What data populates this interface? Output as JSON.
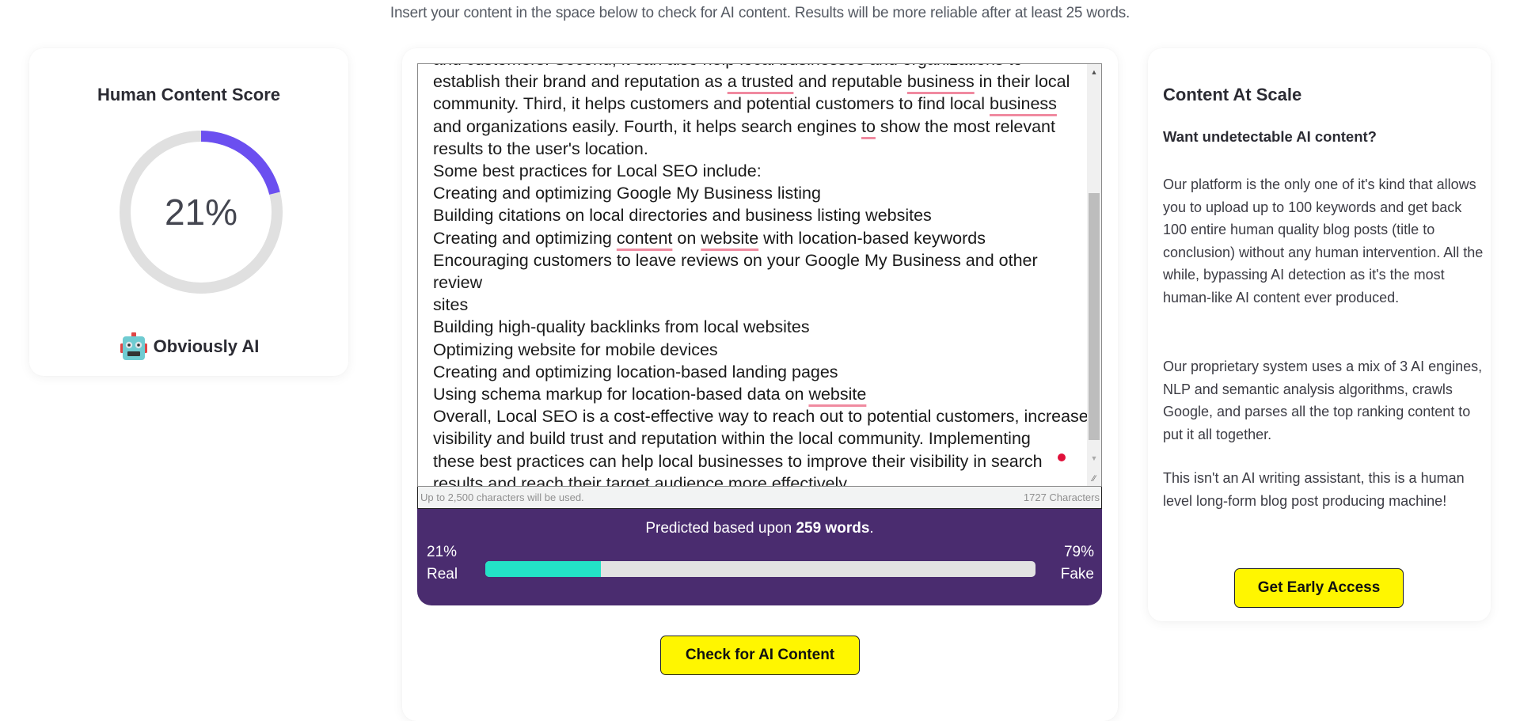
{
  "intro": {
    "text": "Insert your content in the space below to check for AI content. Results will be more reliable after at least 25 words."
  },
  "score_card": {
    "title": "Human Content Score",
    "score_percent": 21,
    "score_label": "21%",
    "ring_colors": {
      "filled": "#6b4ff0",
      "track": "#e0e0e0"
    },
    "verdict_icon": "robot-face-icon",
    "verdict_label": "Obviously AI"
  },
  "editor": {
    "lines": [
      [
        {
          "t": "and customers. Second, it can also help local businesses and organizations to"
        }
      ],
      [
        {
          "t": "establish their brand and reputation as "
        },
        {
          "t": "a trusted",
          "flag": true
        },
        {
          "t": " and reputable "
        },
        {
          "t": "business",
          "flag": true
        },
        {
          "t": " in their local"
        }
      ],
      [
        {
          "t": "community. Third, it helps customers and potential customers to find local "
        },
        {
          "t": "business",
          "flag": true
        }
      ],
      [
        {
          "t": "and organizations easily. Fourth, it helps search engines "
        },
        {
          "t": "to",
          "flag": true
        },
        {
          "t": " show the most relevant"
        }
      ],
      [
        {
          "t": "results to the user's location."
        }
      ],
      [
        {
          "t": "Some best practices for Local SEO include:"
        }
      ],
      [
        {
          "t": "Creating and optimizing Google My Business listing"
        }
      ],
      [
        {
          "t": "Building citations on local directories and business listing websites"
        }
      ],
      [
        {
          "t": "Creating and optimizing "
        },
        {
          "t": "content",
          "flag": true
        },
        {
          "t": " on "
        },
        {
          "t": "website",
          "flag": true
        },
        {
          "t": " with location-based keywords"
        }
      ],
      [
        {
          "t": "Encouraging customers to leave reviews on your Google My Business and other review"
        }
      ],
      [
        {
          "t": "sites"
        }
      ],
      [
        {
          "t": "Building high-quality backlinks from local websites"
        }
      ],
      [
        {
          "t": "Optimizing website for mobile devices"
        }
      ],
      [
        {
          "t": "Creating and optimizing location-based landing pages"
        }
      ],
      [
        {
          "t": "Using schema markup for location-based data on "
        },
        {
          "t": "website",
          "flag": true
        }
      ],
      [
        {
          "t": "Overall, Local SEO is a cost-effective way to reach out to potential customers, increase"
        }
      ],
      [
        {
          "t": "visibility and build trust and reputation within the local community. Implementing"
        }
      ],
      [
        {
          "t": "these best practices can help local businesses to improve their visibility in search"
        }
      ],
      [
        {
          "t": "results and reach their target audience more effectively."
        }
      ]
    ],
    "scroll_up_glyph": "▲",
    "scroll_down_glyph": "▼",
    "resize_glyph": "⁄⁄",
    "footer_left": "Up to 2,500 characters will be used.",
    "footer_right": "1727 Characters"
  },
  "result": {
    "predicted_prefix": "Predicted based upon ",
    "predicted_words": "259 words",
    "predicted_suffix": ".",
    "real_percent": 21,
    "real_pct_label": "21%",
    "real_label": "Real",
    "fake_pct_label": "79%",
    "fake_label": "Fake",
    "colors": {
      "panel": "#4a2c6f",
      "fill": "#23e2c7",
      "track": "#e2e2e2"
    }
  },
  "check_button": {
    "label": "Check for AI Content"
  },
  "promo": {
    "title": "Content At Scale",
    "subtitle": "Want undetectable AI content?",
    "p1": "Our platform is the only one of it's kind that allows you to upload up to 100 keywords and get back 100 entire human quality blog posts (title to conclusion) without any human intervention. All the while, bypassing AI detection as it's the most human-like AI content ever produced.",
    "p2": "Our proprietary system uses a mix of 3 AI engines, NLP and semantic analysis algorithms, crawls Google, and parses all the top ranking content to put it all together.",
    "p3": "This isn't an AI writing assistant, this is a human level long-form blog post producing machine!",
    "button_label": "Get Early Access",
    "button_color": "#fff600"
  }
}
